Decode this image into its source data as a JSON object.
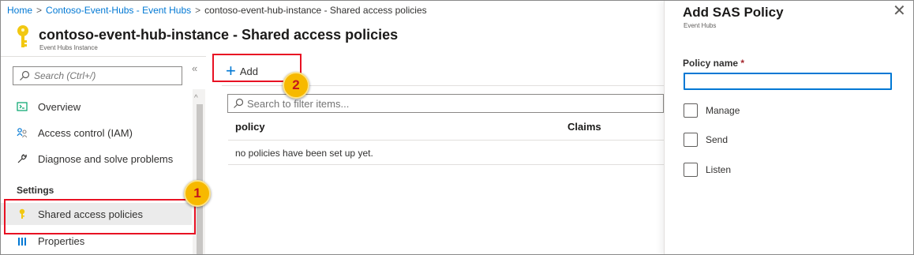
{
  "breadcrumb": {
    "items": [
      "Home",
      "Contoso-Event-Hubs - Event Hubs",
      "contoso-event-hub-instance - Shared access policies"
    ],
    "separator": ">"
  },
  "header": {
    "title": "contoso-event-hub-instance - Shared access policies",
    "subtitle": "Event Hubs Instance",
    "icon": "key-icon"
  },
  "sidebar": {
    "search_placeholder": "Search (Ctrl+/)",
    "collapse_label": "«",
    "items": [
      {
        "label": "Overview",
        "icon": "overview-icon"
      },
      {
        "label": "Access control (IAM)",
        "icon": "people-icon"
      },
      {
        "label": "Diagnose and solve problems",
        "icon": "wrench-icon"
      }
    ],
    "section_title": "Settings",
    "settings_items": [
      {
        "label": "Shared access policies",
        "icon": "key-icon",
        "selected": true
      },
      {
        "label": "Properties",
        "icon": "properties-icon"
      }
    ]
  },
  "main": {
    "add_label": "Add",
    "filter_placeholder": "Search to filter items...",
    "columns": [
      "policy",
      "Claims"
    ],
    "empty_message": "no policies have been set up yet."
  },
  "blade": {
    "title": "Add SAS Policy",
    "subtitle": "Event Hubs",
    "close_label": "✕",
    "policy_name_label": "Policy name",
    "required_marker": "*",
    "policy_name_value": "",
    "checkboxes": [
      {
        "label": "Manage",
        "checked": false
      },
      {
        "label": "Send",
        "checked": false
      },
      {
        "label": "Listen",
        "checked": false
      }
    ]
  },
  "annotations": {
    "step1": "1",
    "step2": "2"
  },
  "colors": {
    "accent": "#0078d4",
    "key": "#f2c811",
    "highlight": "#e81123",
    "badge": "#f7b900"
  }
}
